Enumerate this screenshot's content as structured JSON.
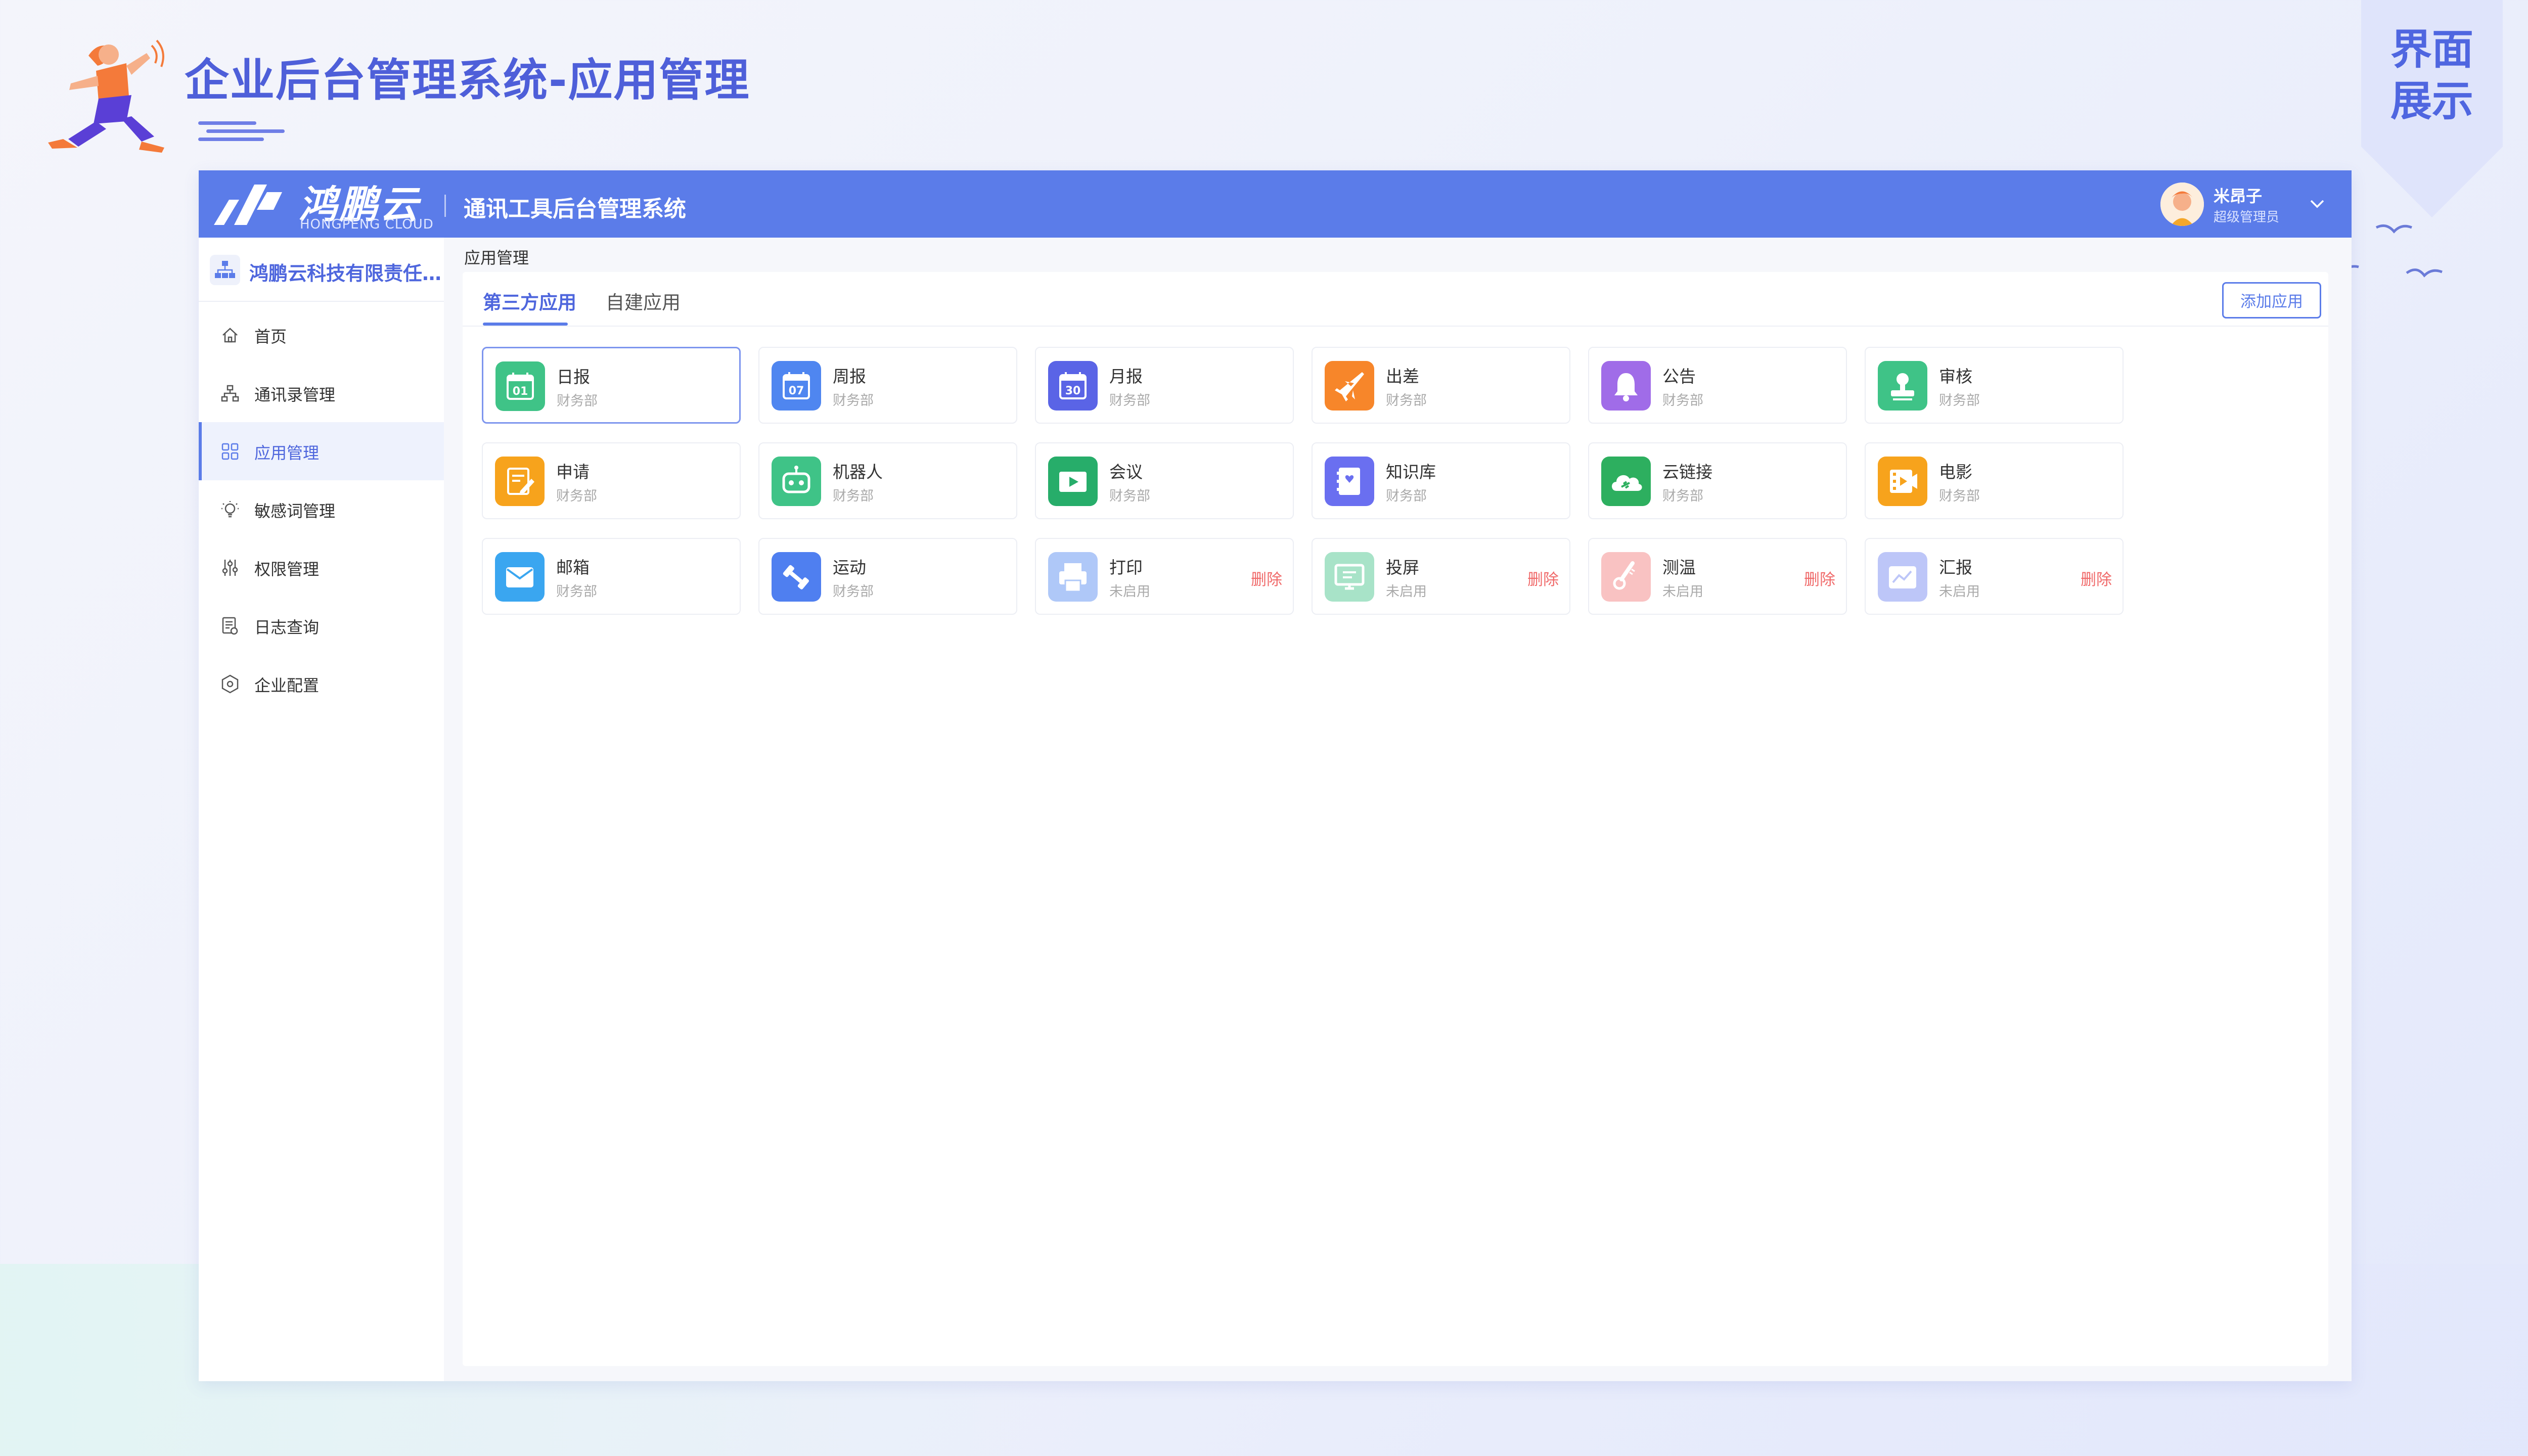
{
  "slide": {
    "title": "企业后台管理系统-应用管理",
    "corner_tag": "界面\n展示"
  },
  "app": {
    "logo_text": "鸿鹏云",
    "logo_sub": "HONGPENG CLOUD",
    "system_name": "通讯工具后台管理系统",
    "user": {
      "name": "米昂子",
      "role": "超级管理员"
    },
    "accent_color": "#5b7ce9"
  },
  "sidebar": {
    "company": "鸿鹏云科技有限责任…",
    "items": [
      {
        "label": "首页",
        "icon": "home-icon"
      },
      {
        "label": "通讯录管理",
        "icon": "org-chart-icon"
      },
      {
        "label": "应用管理",
        "icon": "grid-icon",
        "active": true
      },
      {
        "label": "敏感词管理",
        "icon": "bulb-icon"
      },
      {
        "label": "权限管理",
        "icon": "sliders-icon"
      },
      {
        "label": "日志查询",
        "icon": "log-icon"
      },
      {
        "label": "企业配置",
        "icon": "settings-hex-icon"
      }
    ]
  },
  "content": {
    "breadcrumb": "应用管理",
    "tabs": [
      {
        "label": "第三方应用",
        "active": true
      },
      {
        "label": "自建应用"
      }
    ],
    "add_button": "添加应用",
    "delete_label": "删除",
    "apps": [
      {
        "name": "日报",
        "sub": "财务部",
        "color": "#3fc387",
        "icon": "calendar-icon",
        "icon_text": "01"
      },
      {
        "name": "周报",
        "sub": "财务部",
        "color": "#4f86f0",
        "icon": "calendar-icon",
        "icon_text": "07"
      },
      {
        "name": "月报",
        "sub": "财务部",
        "color": "#5a64e6",
        "icon": "calendar-icon",
        "icon_text": "30"
      },
      {
        "name": "出差",
        "sub": "财务部",
        "color": "#f7862a",
        "icon": "plane-icon"
      },
      {
        "name": "公告",
        "sub": "财务部",
        "color": "#a06ce8",
        "icon": "bell-icon"
      },
      {
        "name": "审核",
        "sub": "财务部",
        "color": "#3fc387",
        "icon": "stamp-icon"
      },
      {
        "name": "申请",
        "sub": "财务部",
        "color": "#f7a31c",
        "icon": "form-icon"
      },
      {
        "name": "机器人",
        "sub": "财务部",
        "color": "#3fc387",
        "icon": "robot-icon"
      },
      {
        "name": "会议",
        "sub": "财务部",
        "color": "#27ad6a",
        "icon": "video-icon"
      },
      {
        "name": "知识库",
        "sub": "财务部",
        "color": "#6a6ff0",
        "icon": "book-icon"
      },
      {
        "name": "云链接",
        "sub": "财务部",
        "color": "#2daf5f",
        "icon": "cloud-link-icon"
      },
      {
        "name": "电影",
        "sub": "财务部",
        "color": "#f7a31c",
        "icon": "film-icon"
      },
      {
        "name": "邮箱",
        "sub": "财务部",
        "color": "#3aa6f0",
        "icon": "mail-icon"
      },
      {
        "name": "运动",
        "sub": "财务部",
        "color": "#4f7ff0",
        "icon": "dumbbell-icon"
      },
      {
        "name": "打印",
        "sub": "未启用",
        "color": "#4f86f0",
        "icon": "printer-icon",
        "disabled": true
      },
      {
        "name": "投屏",
        "sub": "未启用",
        "color": "#3fc387",
        "icon": "screen-icon",
        "disabled": true
      },
      {
        "name": "测温",
        "sub": "未启用",
        "color": "#f27a7a",
        "icon": "thermometer-icon",
        "disabled": true
      },
      {
        "name": "汇报",
        "sub": "未启用",
        "color": "#6f83f0",
        "icon": "report-icon",
        "disabled": true
      }
    ]
  }
}
